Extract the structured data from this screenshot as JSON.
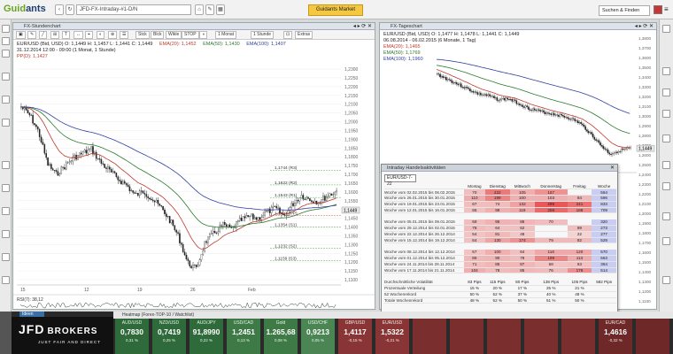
{
  "header": {
    "logo_a": "Guid",
    "logo_b": "ants",
    "address": "JFD-FX-Intraday-#1-D/N",
    "nav_button": "Guidants Market",
    "search": "Suchen & Finden"
  },
  "left_chart": {
    "title": "FX-Stundenchart",
    "tools": [
      "1 Monat",
      "1 Stunde",
      "Extras"
    ],
    "order_tools": [
      "Stck",
      "Blck",
      "Wikle",
      "STOP"
    ],
    "legend_main": "EUR/USD (Bid, USD)  O: 1,1449  H: 1,1457  L: 1,1441  C: 1,1449",
    "ema20": "EMA(20): 1,1452",
    "ema50": "EMA(50): 1,1430",
    "ema100": "EMA(100): 1,1407",
    "date_line": "31.12.2014 12:00 - 09:00 (1 Monat, 1 Stunde)",
    "pp": "PP(D): 1,1427",
    "yticks": [
      "1,2300",
      "1,2250",
      "1,2200",
      "1,2150",
      "1,2100",
      "1,2050",
      "1,2000",
      "1,1950",
      "1,1900",
      "1,1850",
      "1,1800",
      "1,1750",
      "1,1700",
      "1,1650",
      "1,1600",
      "1,1550",
      "1,1500",
      "1,1450",
      "1,1400",
      "1,1350",
      "1,1300",
      "1,1250",
      "1,1200",
      "1,1150",
      "1,1100"
    ],
    "pivots": [
      "1,1744 (R3)",
      "1,1622 (R2)",
      "1,1543 (R1)",
      "1,1427 (PP)",
      "1,1354 (S1)",
      "1,1232 (S2)",
      "1,1159 (S3)"
    ],
    "price_tag": "1,1449",
    "xticks": [
      "15",
      "12",
      "19",
      "26",
      "Feb"
    ],
    "rsi_label": "RSI(7): 38,12"
  },
  "right_chart": {
    "title": "FX-Tageschart",
    "legend_main": "EUR/USD (Bid, USD)  O: 1,1477  H: 1,1478  L: 1,1441  C: 1,1449",
    "date_line": "06.08.2014 - 06.02.2015 (6 Monate, 1 Tag)",
    "ema20": "EMA(20): 1,1465",
    "ema50": "EMA(50): 1,1769",
    "ema100": "EMA(100): 1,1960",
    "yticks": [
      "1,3800",
      "1,3700",
      "1,3600",
      "1,3500",
      "1,3400",
      "1,3300",
      "1,3200",
      "1,3100",
      "1,3000",
      "1,2900",
      "1,2800",
      "1,2700",
      "1,2600",
      "1,2500",
      "1,2400",
      "1,2300",
      "1,2200",
      "1,2100",
      "1,2000",
      "1,1900",
      "1,1800",
      "1,1700",
      "1,1600",
      "1,1500",
      "1,1400",
      "1,1300",
      "1,1200",
      "1,1100"
    ],
    "xticks": [
      "Sep",
      "Okt",
      "Nov",
      "Dez",
      "Jan 15",
      "Feb"
    ],
    "price_tag": "1,1449"
  },
  "overlay": {
    "title": "Intraday Handelsaktivitäten",
    "select": "EUR/USD-7-22",
    "cols": [
      "Montag",
      "Dienstag",
      "Mittwoch",
      "Donnerstag",
      "Freitag",
      "Woche"
    ],
    "groups": [
      [
        [
          "Woche vom 02.02.2015 bis 06.02.2015",
          "70",
          "222",
          "105",
          "167",
          "",
          "564"
        ],
        [
          "Woche vom 26.01.2015 bis 30.01.2015",
          "110",
          "199",
          "100",
          "103",
          "84",
          "596"
        ],
        [
          "Woche vom 19.01.2015 bis 23.01.2015",
          "67",
          "74",
          "132",
          "299",
          "241",
          "833"
        ],
        [
          "Woche vom 12.01.2015 bis 16.01.2015",
          "65",
          "99",
          "119",
          "259",
          "188",
          "709"
        ]
      ],
      [
        [
          "Woche vom 05.01.2015 bis 09.01.2015",
          "69",
          "95",
          "86",
          "70",
          "",
          "320"
        ],
        [
          "Woche vom 29.12.2014 bis 02.01.2015",
          "78",
          "64",
          "62",
          "",
          "69",
          "273"
        ],
        [
          "Woche vom 22.12.2014 bis 26.12.2014",
          "54",
          "81",
          "48",
          "",
          "22",
          "277"
        ],
        [
          "Woche vom 15.12.2014 bis 19.12.2014",
          "64",
          "130",
          "174",
          "79",
          "82",
          "529"
        ]
      ],
      [
        [
          "Woche vom 08.12.2014 bis 12.12.2014",
          "57",
          "100",
          "64",
          "116",
          "120",
          "570"
        ],
        [
          "Woche vom 01.12.2014 bis 05.12.2014",
          "86",
          "90",
          "78",
          "199",
          "113",
          "563"
        ],
        [
          "Woche vom 24.11.2014 bis 28.11.2014",
          "71",
          "85",
          "87",
          "58",
          "63",
          "364"
        ],
        [
          "Woche vom 17.11.2014 bis 21.11.2014",
          "104",
          "78",
          "85",
          "76",
          "178",
          "514"
        ]
      ]
    ],
    "summary": [
      [
        "Durchschnittliche Volatilität",
        "83 Pips",
        "115 Pips",
        "80 Pips",
        "138 Pips",
        "105 Pips",
        "582 Pips"
      ],
      [
        "Prozentuale Verteilung",
        "15 %",
        "20 %",
        "17 %",
        "25 %",
        "21 %",
        ""
      ],
      [
        "52 Wochenrekord",
        "50 %",
        "52 %",
        "37 %",
        "40 %",
        "48 %",
        ""
      ],
      [
        "Totale Wochenrekord",
        "48 %",
        "52 %",
        "50 %",
        "51 %",
        "50 %",
        ""
      ]
    ]
  },
  "heatmap": {
    "title": "Heatmap (Forex-TOP-10 / Watchlist)",
    "tab": "Ideen",
    "cells": [
      {
        "sym": "AUD/USD",
        "val": "0,7830",
        "pct": "0,31 %",
        "color": "#2f6b3a"
      },
      {
        "sym": "NZD/USD",
        "val": "0,7419",
        "pct": "0,25 %",
        "color": "#2f6b3a"
      },
      {
        "sym": "AUD/JPY",
        "val": "91,8990",
        "pct": "0,22 %",
        "color": "#2f6b3a"
      },
      {
        "sym": "USD/CAD",
        "val": "1,2451",
        "pct": "0,13 %",
        "color": "#3d7a46"
      },
      {
        "sym": "Gold",
        "val": "1.265,68",
        "pct": "0,08 %",
        "color": "#3d7a46"
      },
      {
        "sym": "USD/CHF",
        "val": "0,9213",
        "pct": "0,05 %",
        "color": "#4a8553"
      },
      {
        "sym": "GBP/USD",
        "val": "1,4117",
        "pct": "-0,15 %",
        "color": "#8a3535"
      },
      {
        "sym": "EUR/USD",
        "val": "1,5322",
        "pct": "-0,21 %",
        "color": "#8a3535"
      },
      {
        "sym": "",
        "val": "",
        "pct": "",
        "color": "#7a2e2e"
      },
      {
        "sym": "",
        "val": "",
        "pct": "",
        "color": "#7a2e2e"
      },
      {
        "sym": "",
        "val": "",
        "pct": "",
        "color": "#7a2e2e"
      },
      {
        "sym": "",
        "val": "",
        "pct": "",
        "color": "#7a2e2e"
      },
      {
        "sym": "",
        "val": "",
        "pct": "",
        "color": "#7a2e2e"
      },
      {
        "sym": "EUR/CAD",
        "val": "1,4616",
        "pct": "-0,32 %",
        "color": "#6e2828"
      },
      {
        "sym": "",
        "val": "",
        "pct": "",
        "color": "#6e2828"
      }
    ]
  },
  "jfd": {
    "name": "JFD",
    "name2": "BROKERS",
    "tagline": "JUST FAIR AND DIRECT"
  },
  "colors": {
    "ema20": "#c0392b",
    "ema50": "#2a7a2a",
    "ema100": "#3040a0",
    "candle": "#333"
  }
}
